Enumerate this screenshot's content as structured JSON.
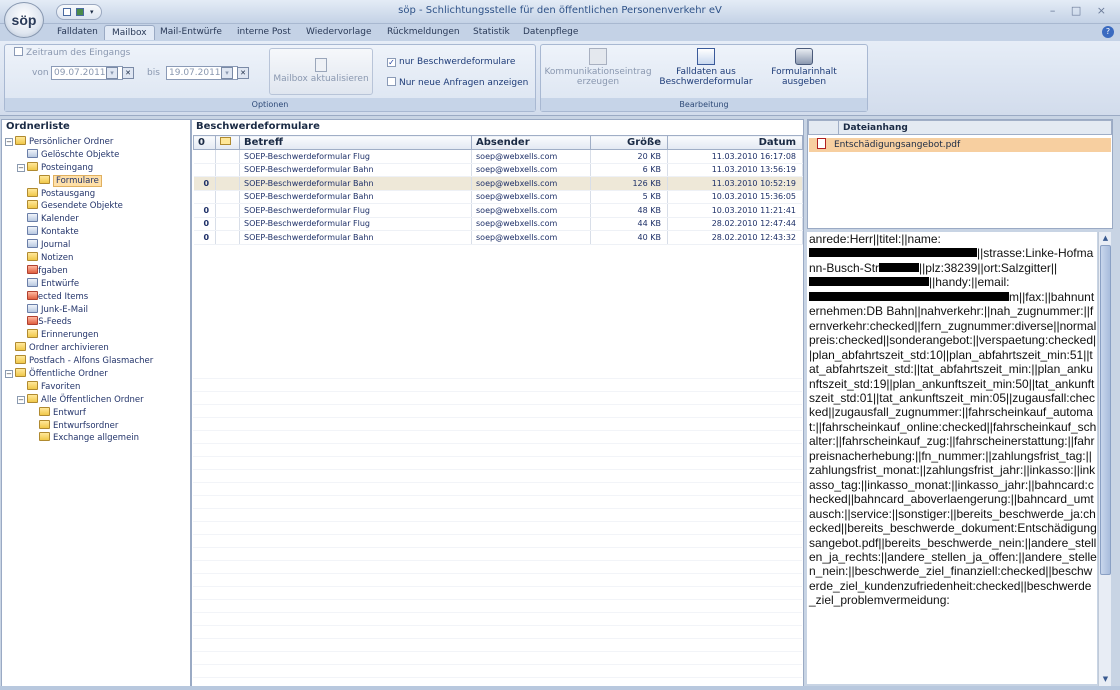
{
  "app": {
    "logo": "söp",
    "title": "söp - Schlichtungsstelle für den öffentlichen Personenverkehr eV",
    "window_controls": "– □ ×"
  },
  "tabs": [
    "Falldaten",
    "Mailbox",
    "Mail-Entwürfe",
    "interne Post",
    "Wiedervorlage",
    "Rückmeldungen",
    "Statistik",
    "Datenpflege"
  ],
  "active_tab": "Mailbox",
  "options": {
    "zeitraum_label": "Zeitraum des Eingangs",
    "von_label": "von",
    "von_value": "09.07.2011",
    "bis_label": "bis",
    "bis_value": "19.07.2011",
    "refresh_label": "Mailbox aktualisieren",
    "only_forms_label": "nur Beschwerdeformulare",
    "only_forms_checked": "✓",
    "only_new_label": "Nur neue Anfragen anzeigen",
    "group_label": "Optionen"
  },
  "bearbeitung": {
    "komm_label": "Kommunikationseintrag erzeugen",
    "falldaten_label": "Falldaten aus Beschwerdeformular",
    "formular_label": "Formularinhalt ausgeben",
    "group_label": "Bearbeitung"
  },
  "folders": {
    "title": "Ordnerliste",
    "items": [
      "Persönlicher Ordner",
      "Gelöschte Objekte",
      "Posteingang",
      "Formulare",
      "Postausgang",
      "Gesendete Objekte",
      "Kalender",
      "Kontakte",
      "Journal",
      "Notizen",
      "Aufgaben",
      "Entwürfe",
      "Infected Items",
      "Junk-E-Mail",
      "RSS-Feeds",
      "Erinnerungen",
      "Ordner archivieren",
      "Postfach - Alfons Glasmacher",
      "Öffentliche Ordner",
      "Favoriten",
      "Alle Öffentlichen Ordner",
      "Entwurf",
      "Entwurfsordner",
      "Exchange allgemein"
    ],
    "selected": "Formulare"
  },
  "forms": {
    "title": "Beschwerdeformulare",
    "columns": {
      "attach": "0",
      "flag": "",
      "subject": "Betreff",
      "sender": "Absender",
      "size": "Größe",
      "date": "Datum"
    },
    "rows": [
      {
        "attach": "",
        "subject": "SOEP-Beschwerdeformular Flug",
        "sender": "soep@webxells.com",
        "size": "20 KB",
        "date": "11.03.2010 16:17:08"
      },
      {
        "attach": "",
        "subject": "SOEP-Beschwerdeformular Bahn",
        "sender": "soep@webxells.com",
        "size": "6 KB",
        "date": "11.03.2010 13:56:19"
      },
      {
        "attach": "0",
        "subject": "SOEP-Beschwerdeformular Bahn",
        "sender": "soep@webxells.com",
        "size": "126 KB",
        "date": "11.03.2010 10:52:19"
      },
      {
        "attach": "",
        "subject": "SOEP-Beschwerdeformular Bahn",
        "sender": "soep@webxells.com",
        "size": "5 KB",
        "date": "10.03.2010 15:36:05"
      },
      {
        "attach": "0",
        "subject": "SOEP-Beschwerdeformular Flug",
        "sender": "soep@webxells.com",
        "size": "48 KB",
        "date": "10.03.2010 11:21:41"
      },
      {
        "attach": "0",
        "subject": "SOEP-Beschwerdeformular Flug",
        "sender": "soep@webxells.com",
        "size": "44 KB",
        "date": "28.02.2010 12:47:44"
      },
      {
        "attach": "0",
        "subject": "SOEP-Beschwerdeformular Bahn",
        "sender": "soep@webxells.com",
        "size": "40 KB",
        "date": "28.02.2010 12:43:32"
      }
    ]
  },
  "attachments": {
    "title": "Dateianhang",
    "items": [
      "Entschädigungsangebot.pdf"
    ]
  },
  "content": {
    "segments": [
      "anrede:Herr||titel:",
      "||name:",
      "||strasse:Linke-",
      "Hofmann-Busch-Str",
      "||plz:",
      "38239",
      "||ort:Salzgitter||",
      "||handy:",
      "||email:",
      "m||fax:||bahnunternehmen:DB Bahn||nahverkehr:",
      "||nah_zugnummer:",
      "||fernverkehr:checked||fern_zugnummer:diverse||normalpreis:checked||sonderangebot:",
      "||verspaetung:checked||plan_abfahrtszeit_std:10",
      "||plan_abfahrtszeit_min:51||tat_abfahrtszeit_std:",
      "||tat_abfahrtszeit_min:||plan_ankunftszeit_std:19",
      "||plan_ankunftszeit_min:50||tat_ankunftszeit_std:01",
      "||tat_ankunftszeit_min:05",
      "||zugausfall:checked||zugausfall_zugnummer:",
      "||fahrscheinkauf_automat:",
      "||fahrscheinkauf_online:checked||fahrscheinkauf_schalter:||fahrscheinkauf_zug:||fahrscheinerstattung:",
      "||fahrpreisnacherhebung:||fn_nummer:",
      "||zahlungsfrist_tag:||zahlungsfrist_monat:",
      "||zahlungsfrist_jahr:||inkasso:||inkasso_tag:",
      "||inkasso_monat:||inkasso_jahr:",
      "||bahncard:checked||bahncard_aboverlaengerung:",
      "||bahncard_umtausch:||service:||sonstiger:",
      "||bereits_beschwerde_ja:checked||bereits_beschwerde_dokument:Entschädigungsangebot.pdf||bereits_beschwerde_nein:||andere_stellen_ja_rechts:",
      "||andere_stellen_ja_offen:||andere_stellen_nein:",
      "||beschwerde_ziel_finanziell:checked||beschwerde_ziel_kundenzufriedenheit:checked||beschwerde_ziel_problemvermeidung:"
    ]
  }
}
